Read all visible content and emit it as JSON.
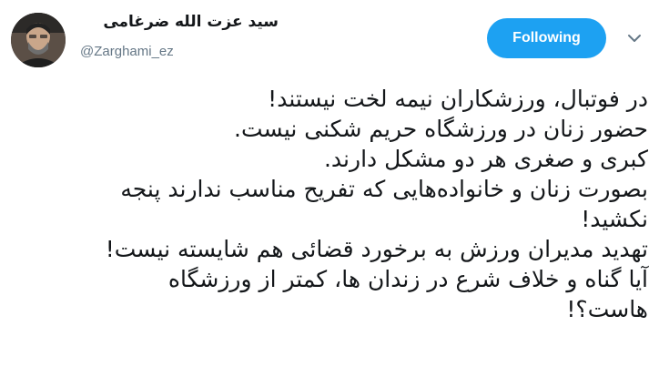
{
  "header": {
    "display_name": "سید عزت الله ضرغامی",
    "handle": "@Zarghami_ez",
    "follow_label": "Following",
    "avatar_icon": "profile-photo",
    "caret_icon": "chevron-down-icon"
  },
  "colors": {
    "accent": "#1da1f2",
    "text": "#14171a",
    "secondary": "#657786"
  },
  "tweet": {
    "lines": [
      "در فوتبال، ورزشکاران نیمه لخت نیستند!",
      "حضور زنان در ورزشگاه حریم شکنی نیست.",
      "کبری و صغری هر دو مشکل دارند.",
      "بصورت زنان و خانواده‌هایی که تفریح مناسب ندارند پنجه",
      "نکشید!",
      "تهدید مدیران ورزش به برخورد قضائی هم شایسته نیست!",
      "آیا گناه و خلاف شرع در زندان ها، کمتر از ورزشگاه",
      "هاست؟!"
    ]
  }
}
